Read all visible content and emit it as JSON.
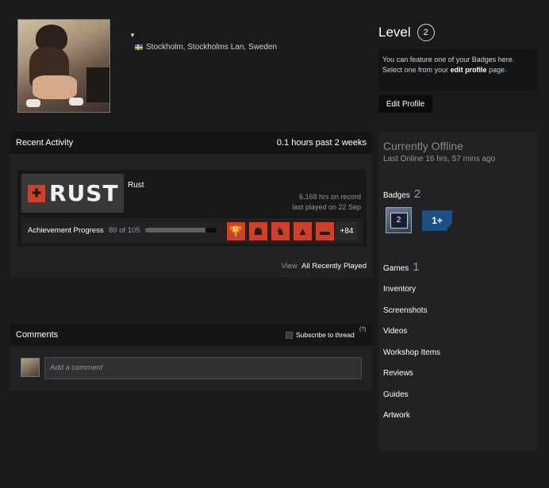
{
  "profile": {
    "location": "Stockholm, Stockholms Lan, Sweden",
    "level_label": "Level",
    "level_value": "2",
    "feature_text_1": "You can feature one of your Badges here. Select one from your",
    "feature_link": "edit profile",
    "feature_text_2": "page.",
    "edit_profile_label": "Edit Profile"
  },
  "recent_activity": {
    "title": "Recent Activity",
    "hours_summary": "0.1 hours past 2 weeks",
    "game": {
      "name": "Rust",
      "logo_text": "RUST",
      "hours_on_record": "6,168 hrs on record",
      "last_played": "last played on 22 Sep",
      "achievement_label": "Achievement Progress",
      "achievement_count": "89 of 105",
      "achievement_progress": 0.848,
      "achievement_more": "+84",
      "achievement_icons": [
        "trophy-icon",
        "mask-icon",
        "bear-icon",
        "rocket-icon",
        "tank-icon"
      ]
    },
    "view_prefix": "View",
    "view_link": "All Recently Played"
  },
  "comments": {
    "title": "Comments",
    "subscribe_label": "Subscribe to thread",
    "help_mark": "(?)",
    "placeholder": "Add a comment"
  },
  "sidebar": {
    "status": "Currently Offline",
    "last_online": "Last Online 16 hrs, 57 mins ago",
    "badges_label": "Badges",
    "badges_count": "2",
    "badge_1_text": "2",
    "badge_2_text": "1+",
    "games_label": "Games",
    "games_count": "1",
    "links": [
      "Inventory",
      "Screenshots",
      "Videos",
      "Workshop Items",
      "Reviews",
      "Guides",
      "Artwork"
    ]
  },
  "colors": {
    "accent_orange": "#cd412b",
    "background": "#1b1b1c",
    "panel": "#222224"
  }
}
